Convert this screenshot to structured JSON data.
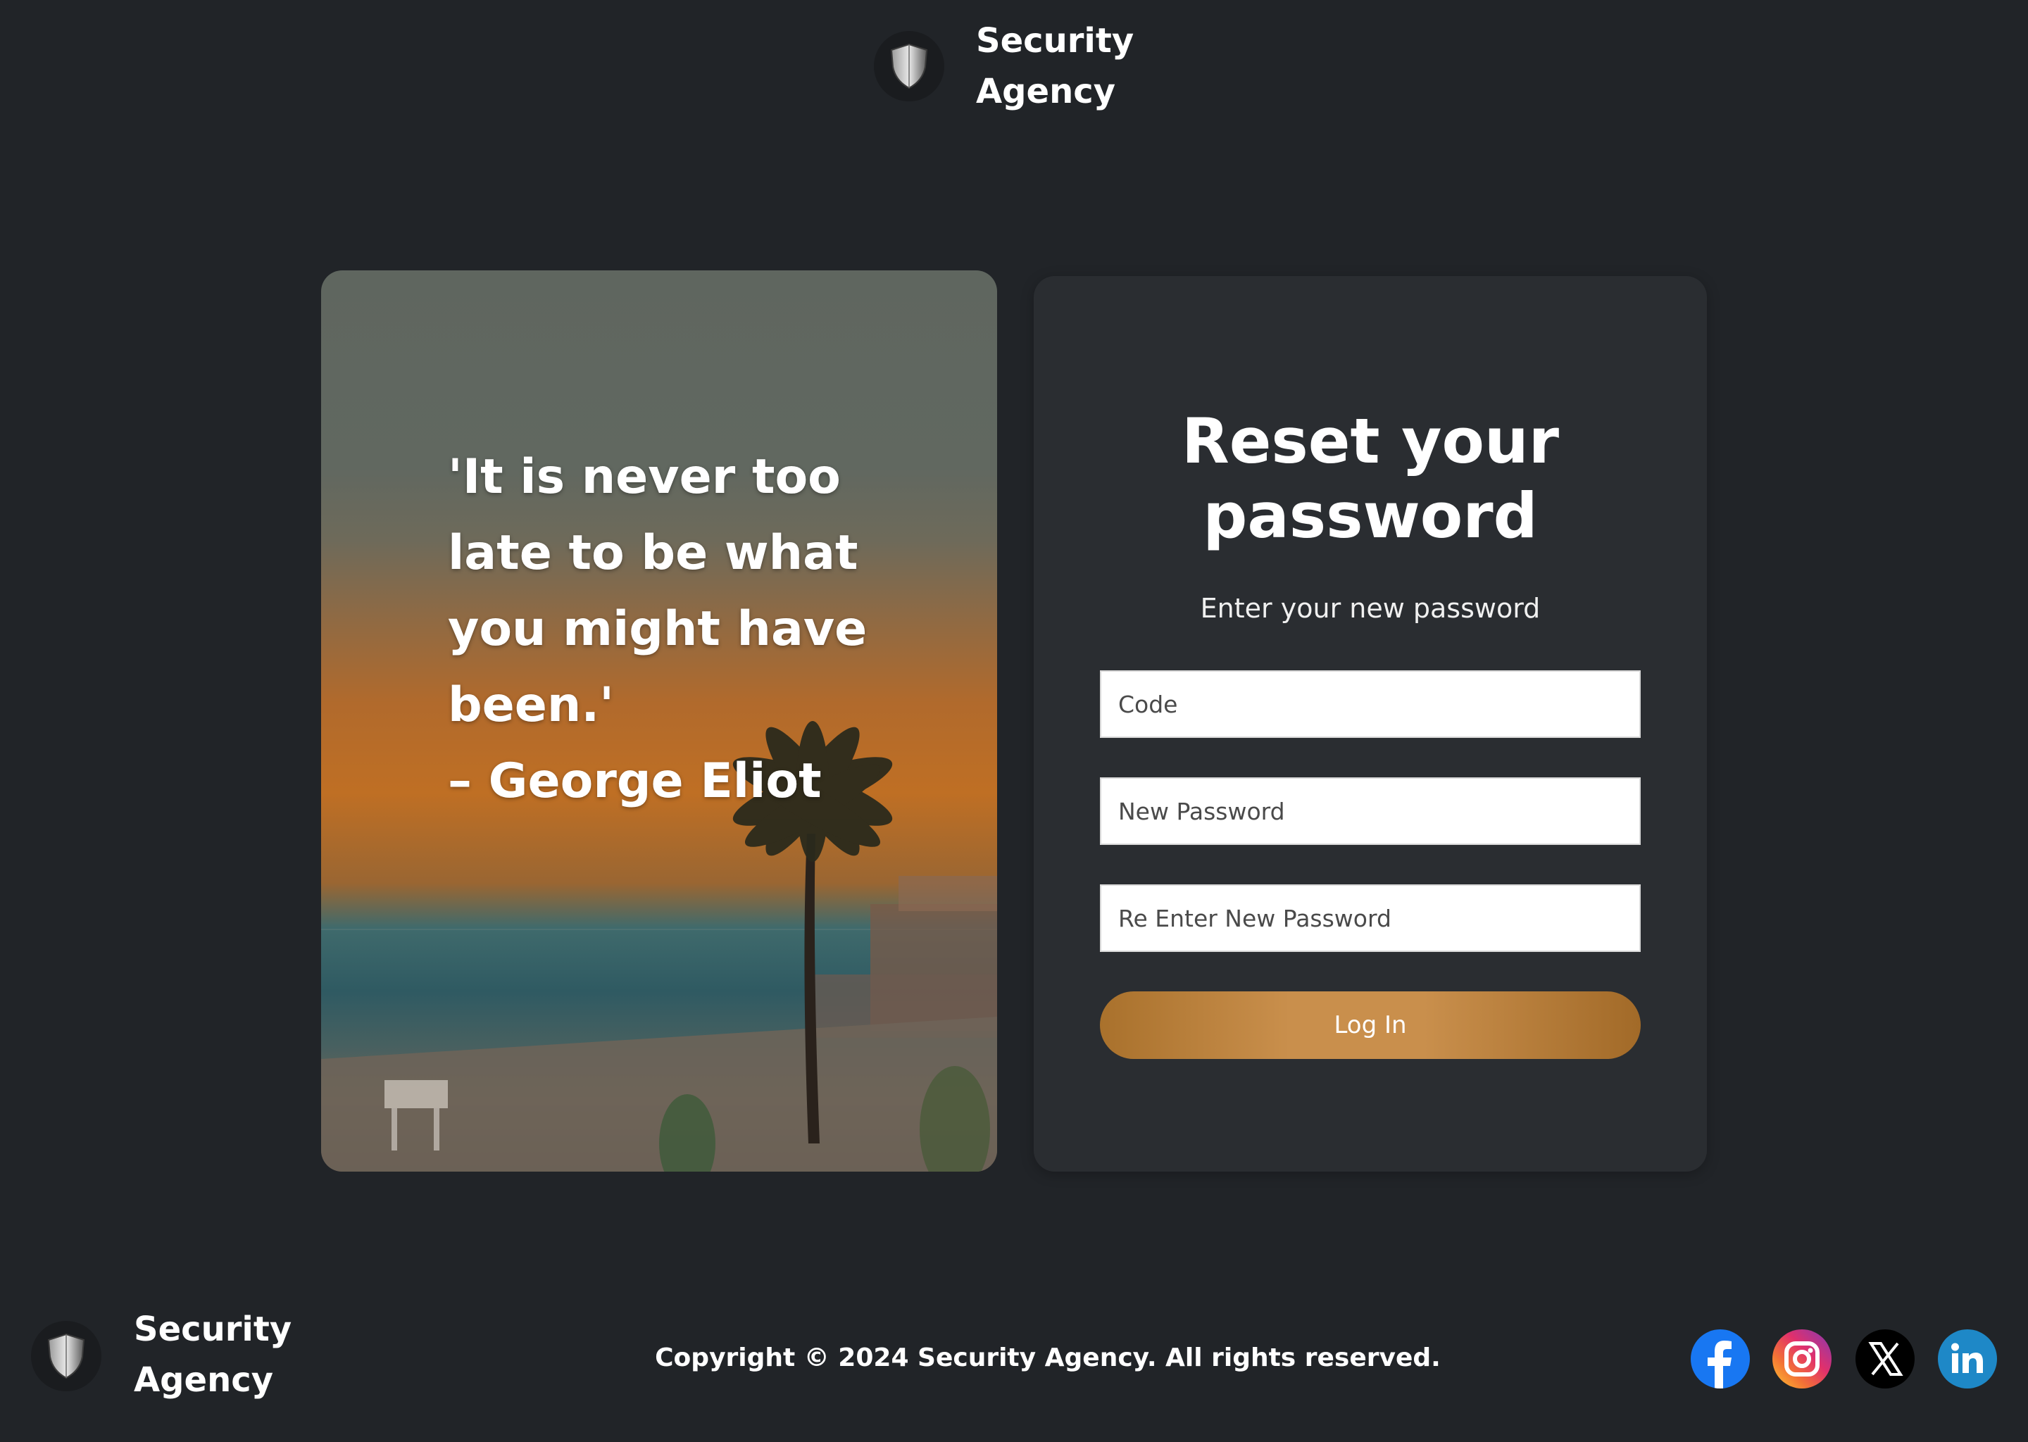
{
  "header": {
    "brand_line1": "Security",
    "brand_line2": "Agency",
    "logo_icon": "shield-icon"
  },
  "quote": {
    "line1": "'It is never too",
    "line2": "late to be what",
    "line3": "you might have",
    "line4": "been.'",
    "author": "– George Eliot"
  },
  "form": {
    "title_line1": "Reset your",
    "title_line2": "password",
    "subtitle": "Enter your new password",
    "code_placeholder": "Code",
    "new_password_placeholder": "New Password",
    "reenter_password_placeholder": "Re Enter New Password",
    "submit_label": "Log In"
  },
  "footer": {
    "brand_line1": "Security",
    "brand_line2": "Agency",
    "copyright": "Copyright © 2024 Security Agency. All rights reserved.",
    "social": [
      "facebook-icon",
      "instagram-icon",
      "x-icon",
      "linkedin-icon"
    ]
  },
  "colors": {
    "background": "#212428",
    "card": "#2a2d31",
    "accent": "#c98f4c"
  }
}
